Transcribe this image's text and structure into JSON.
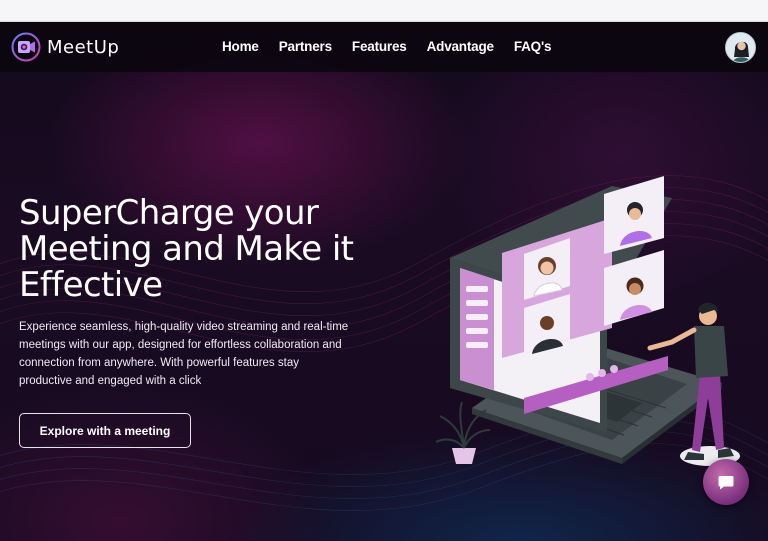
{
  "brand": {
    "name": "MeetUp",
    "logo_icon": "camera-logo-icon"
  },
  "nav": {
    "items": [
      {
        "label": "Home"
      },
      {
        "label": "Partners"
      },
      {
        "label": "Features"
      },
      {
        "label": "Advantage"
      },
      {
        "label": "FAQ's"
      }
    ],
    "avatar_icon": "user-avatar"
  },
  "hero": {
    "title": "SuperCharge your Meeting and Make it Effective",
    "description": "Experience seamless, high-quality video streaming and real-time meetings with our app, designed for effortless collaboration and connection from anywhere. With powerful features stay productive and engaged with a click",
    "cta_label": "Explore with a meeting",
    "illustration": "video-conference-laptop-illustration"
  },
  "chat": {
    "icon": "chat-bubble-icon"
  },
  "colors": {
    "background": "#12091a",
    "accent": "#c46cae",
    "navbar": "#0a060e",
    "text": "#ffffff"
  }
}
